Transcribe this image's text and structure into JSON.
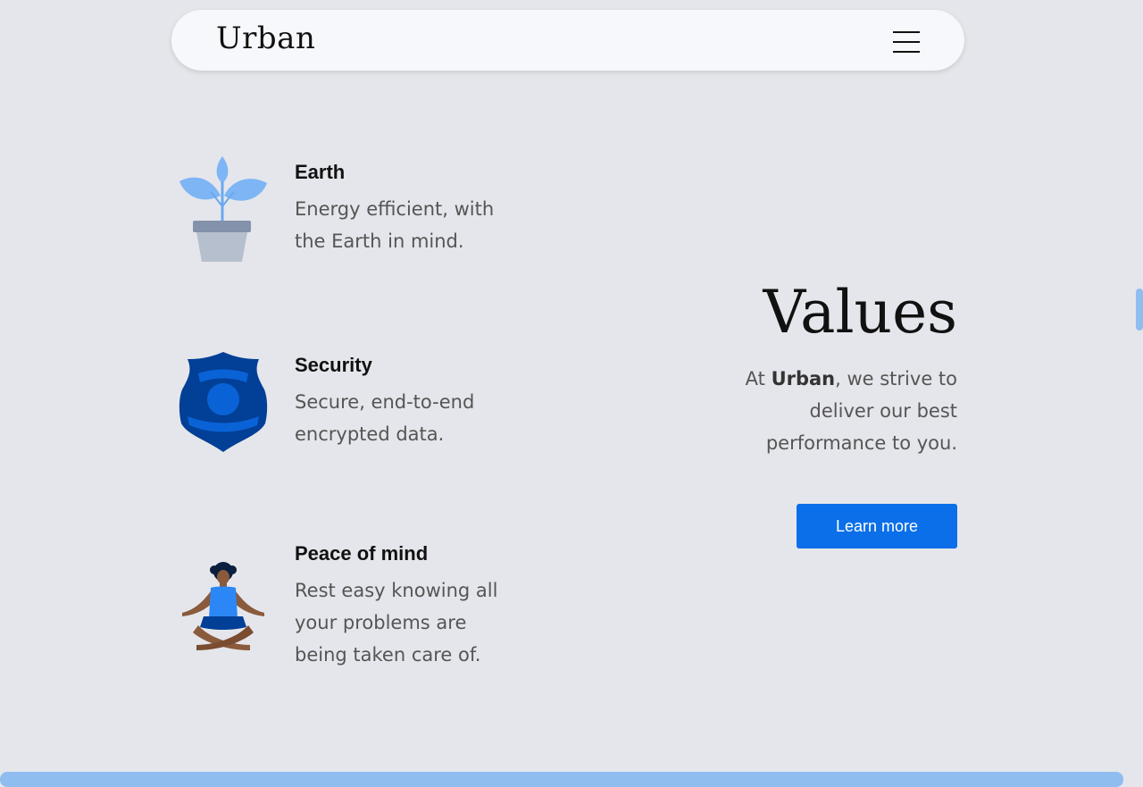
{
  "nav": {
    "brand": "Urban",
    "menu_icon": "hamburger-menu-icon"
  },
  "features": [
    {
      "icon": "plant-pot-icon",
      "title": "Earth",
      "text_line1": "Energy efficient, with",
      "text_line2": "the Earth in mind."
    },
    {
      "icon": "shield-badge-icon",
      "title": "Security",
      "text_line1": "Secure, end-to-end",
      "text_line2": "encrypted data."
    },
    {
      "icon": "meditating-person-icon",
      "title": "Peace of mind",
      "text_line1": "Rest easy knowing all",
      "text_line2": "your problems are",
      "text_line3": "being taken care of."
    }
  ],
  "values": {
    "title": "Values",
    "prefix": "At ",
    "brand": "Urban",
    "line1_suffix": ", we strive to",
    "line2": "deliver our best",
    "line3": "performance to you.",
    "button_label": "Learn more"
  },
  "colors": {
    "background": "#e5e6eb",
    "accent": "#0a6fe8",
    "scrollbar": "#8fbdf0"
  }
}
